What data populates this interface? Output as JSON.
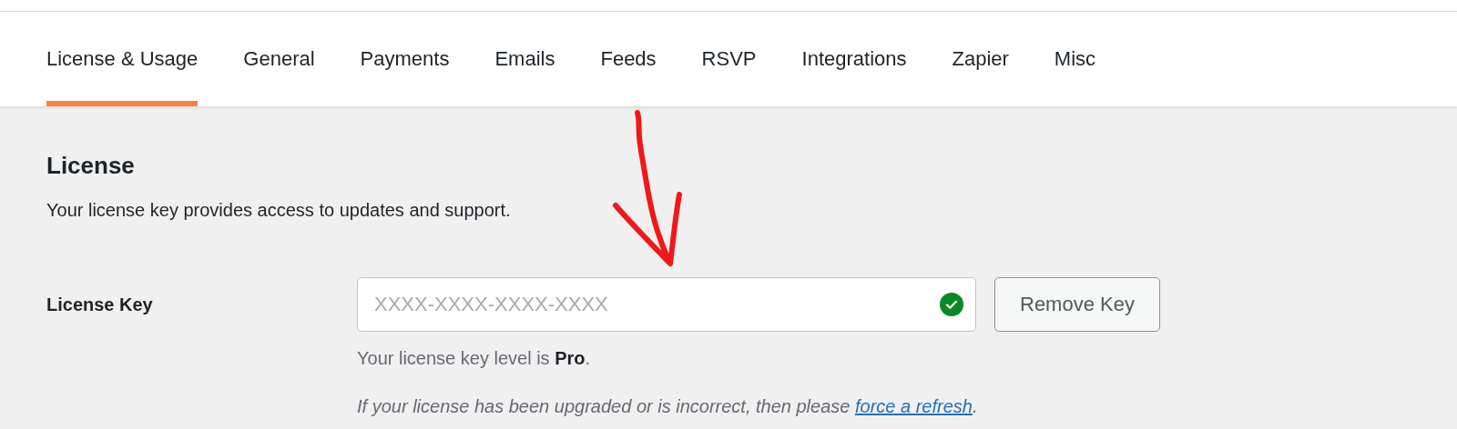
{
  "tabs": [
    {
      "label": "License & Usage",
      "selected": true
    },
    {
      "label": "General",
      "selected": false
    },
    {
      "label": "Payments",
      "selected": false
    },
    {
      "label": "Emails",
      "selected": false
    },
    {
      "label": "Feeds",
      "selected": false
    },
    {
      "label": "RSVP",
      "selected": false
    },
    {
      "label": "Integrations",
      "selected": false
    },
    {
      "label": "Zapier",
      "selected": false
    },
    {
      "label": "Misc",
      "selected": false
    }
  ],
  "section": {
    "title": "License",
    "description": "Your license key provides access to updates and support."
  },
  "license_key": {
    "label": "License Key",
    "placeholder": "XXXX-XXXX-XXXX-XXXX",
    "valid": true,
    "button": "Remove Key"
  },
  "level_note": "Your license key level is **Pro**.",
  "refresh_note": {
    "text": "If your license has been upgraded or is incorrect, then please ",
    "link": "force a refresh",
    "after": "."
  }
}
